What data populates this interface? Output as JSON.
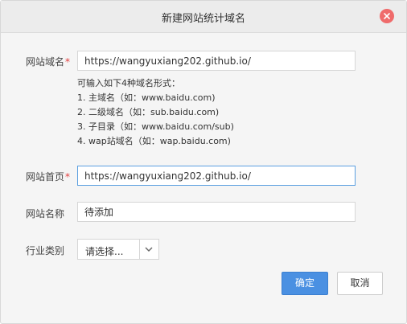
{
  "dialog": {
    "title": "新建网站统计域名",
    "close_icon": "close-icon"
  },
  "form": {
    "domain": {
      "label": "网站域名",
      "required_mark": "*",
      "value": "https://wangyuxiang202.github.io/"
    },
    "hint": {
      "intro": "可输入如下4种域名形式：",
      "lines": [
        "1. 主域名（如：www.baidu.com)",
        "2. 二级域名（如：sub.baidu.com)",
        "3. 子目录（如：www.baidu.com/sub)",
        "4. wap站域名（如：wap.baidu.com)"
      ]
    },
    "homepage": {
      "label": "网站首页",
      "required_mark": "*",
      "value": "https://wangyuxiang202.github.io/"
    },
    "site_name": {
      "label": "网站名称",
      "value": "待添加"
    },
    "industry": {
      "label": "行业类别",
      "selected": "请选择...",
      "arrow_icon": "chevron-down-icon"
    }
  },
  "buttons": {
    "confirm": "确定",
    "cancel": "取消"
  },
  "colors": {
    "primary": "#4a90e2",
    "close": "#ef6b6b",
    "required": "#e34040",
    "focus_border": "#5b9fe0"
  }
}
